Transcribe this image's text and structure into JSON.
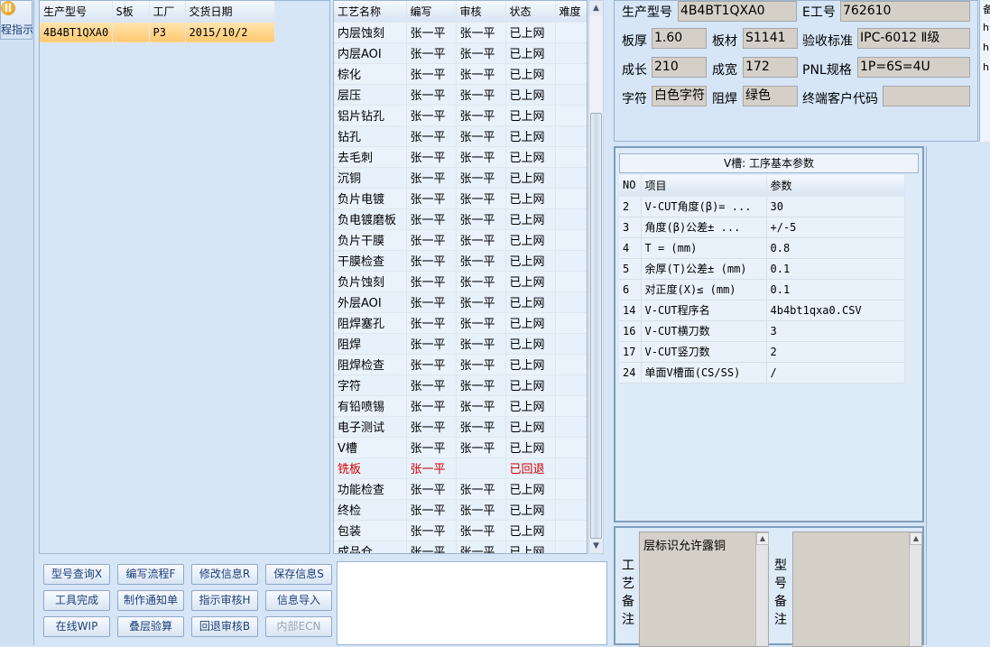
{
  "sidebar": {
    "label": "程指示"
  },
  "product_list": {
    "columns": [
      "生产型号",
      "S板",
      "工厂",
      "交货日期"
    ],
    "rows": [
      {
        "model": "4B4BT1QXA0",
        "s": "",
        "factory": "P3",
        "date": "2015/10/2"
      }
    ]
  },
  "process_list": {
    "columns": [
      "工艺名称",
      "编写",
      "审核",
      "状态",
      "难度"
    ],
    "rows": [
      {
        "name": "内层蚀刻",
        "writer": "张一平",
        "reviewer": "张一平",
        "status": "已上网"
      },
      {
        "name": "内层AOI",
        "writer": "张一平",
        "reviewer": "张一平",
        "status": "已上网"
      },
      {
        "name": "棕化",
        "writer": "张一平",
        "reviewer": "张一平",
        "status": "已上网"
      },
      {
        "name": "层压",
        "writer": "张一平",
        "reviewer": "张一平",
        "status": "已上网"
      },
      {
        "name": "铝片钻孔",
        "writer": "张一平",
        "reviewer": "张一平",
        "status": "已上网"
      },
      {
        "name": "钻孔",
        "writer": "张一平",
        "reviewer": "张一平",
        "status": "已上网"
      },
      {
        "name": "去毛刺",
        "writer": "张一平",
        "reviewer": "张一平",
        "status": "已上网"
      },
      {
        "name": "沉铜",
        "writer": "张一平",
        "reviewer": "张一平",
        "status": "已上网"
      },
      {
        "name": "负片电镀",
        "writer": "张一平",
        "reviewer": "张一平",
        "status": "已上网"
      },
      {
        "name": "负电镀磨板",
        "writer": "张一平",
        "reviewer": "张一平",
        "status": "已上网"
      },
      {
        "name": "负片干膜",
        "writer": "张一平",
        "reviewer": "张一平",
        "status": "已上网"
      },
      {
        "name": "干膜检查",
        "writer": "张一平",
        "reviewer": "张一平",
        "status": "已上网"
      },
      {
        "name": "负片蚀刻",
        "writer": "张一平",
        "reviewer": "张一平",
        "status": "已上网"
      },
      {
        "name": "外层AOI",
        "writer": "张一平",
        "reviewer": "张一平",
        "status": "已上网"
      },
      {
        "name": "阻焊塞孔",
        "writer": "张一平",
        "reviewer": "张一平",
        "status": "已上网"
      },
      {
        "name": "阻焊",
        "writer": "张一平",
        "reviewer": "张一平",
        "status": "已上网"
      },
      {
        "name": "阻焊检查",
        "writer": "张一平",
        "reviewer": "张一平",
        "status": "已上网"
      },
      {
        "name": "字符",
        "writer": "张一平",
        "reviewer": "张一平",
        "status": "已上网"
      },
      {
        "name": "有铅喷锡",
        "writer": "张一平",
        "reviewer": "张一平",
        "status": "已上网"
      },
      {
        "name": "电子测试",
        "writer": "张一平",
        "reviewer": "张一平",
        "status": "已上网"
      },
      {
        "name": "V槽",
        "writer": "张一平",
        "reviewer": "张一平",
        "status": "已上网"
      },
      {
        "name": "铣板",
        "writer": "张一平",
        "reviewer": "",
        "status": "已回退"
      },
      {
        "name": "功能检查",
        "writer": "张一平",
        "reviewer": "张一平",
        "status": "已上网"
      },
      {
        "name": "终检",
        "writer": "张一平",
        "reviewer": "张一平",
        "status": "已上网"
      },
      {
        "name": "包装",
        "writer": "张一平",
        "reviewer": "张一平",
        "status": "已上网"
      },
      {
        "name": "成品仓",
        "writer": "张一平",
        "reviewer": "张一平",
        "status": "已上网"
      }
    ]
  },
  "buttons": [
    "型号查询X",
    "编写流程F",
    "修改信息R",
    "保存信息S",
    "工具完成",
    "制作通知单",
    "指示审核H",
    "信息导入",
    "在线WIP",
    "叠层验算",
    "回退审核B",
    "内部ECN"
  ],
  "info": {
    "model_label": "生产型号",
    "model_value": "4B4BT1QXA0",
    "e_label": "E工号",
    "e_value": "762610",
    "thick_label": "板厚",
    "thick_value": "1.60",
    "material_label": "板材",
    "material_value": "S1141",
    "std_label": "验收标准",
    "std_value": "IPC-6012 Ⅱ级",
    "length_label": "成长",
    "length_value": "210",
    "width_label": "成宽",
    "width_value": "172",
    "pnl_label": "PNL规格",
    "pnl_value": "1P=6S=4U",
    "char_label": "字符",
    "char_value": "白色字符",
    "mask_label": "阻焊",
    "mask_value": "绿色",
    "customer_label": "终端客户代码",
    "customer_value": "",
    "far_right": [
      "备",
      "h",
      "h",
      "h"
    ]
  },
  "vcut": {
    "title": "V槽: 工序基本参数",
    "columns": [
      "NO",
      "项目",
      "参数"
    ],
    "rows": [
      {
        "no": "2",
        "item": "V-CUT角度(β)=  ...",
        "value": "30"
      },
      {
        "no": "3",
        "item": "角度(β)公差±  ...",
        "value": "+/-5"
      },
      {
        "no": "4",
        "item": "T =  (mm)",
        "value": "0.8"
      },
      {
        "no": "5",
        "item": "余厚(T)公差±  (mm)",
        "value": "0.1"
      },
      {
        "no": "6",
        "item": "对正度(X)≤ (mm)",
        "value": "0.1"
      },
      {
        "no": "14",
        "item": "V-CUT程序名",
        "value": "4b4bt1qxa0.CSV"
      },
      {
        "no": "16",
        "item": "V-CUT横刀数",
        "value": "3"
      },
      {
        "no": "17",
        "item": "V-CUT竖刀数",
        "value": "2"
      },
      {
        "no": "24",
        "item": "单面V槽面(CS/SS)",
        "value": "/"
      }
    ]
  },
  "remarks": {
    "process_label": "工艺备注",
    "process_text": "层标识允许露铜",
    "model_label": "型号备注",
    "model_text": ""
  }
}
